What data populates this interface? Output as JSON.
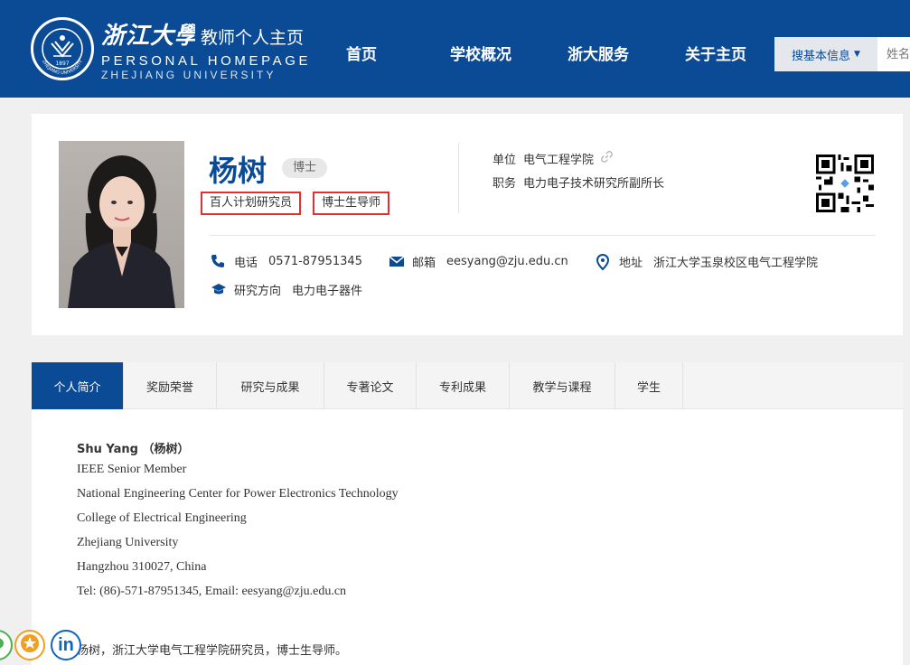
{
  "header": {
    "logo_cn": "浙江大學",
    "logo_sub": "教师个人主页",
    "logo_en1": "PERSONAL HOMEPAGE",
    "logo_en2": "ZHEJIANG UNIVERSITY",
    "seal_year": "1897",
    "seal_text": "ZHEJIANG UNIVERSITY",
    "nav": [
      "首页",
      "学校概况",
      "浙大服务",
      "关于主页"
    ],
    "search": {
      "select_label": "搜基本信息",
      "placeholder": "姓名"
    }
  },
  "profile": {
    "name": "杨树",
    "degree": "博士",
    "tags": [
      "百人计划研究员",
      "博士生导师"
    ],
    "unit_label": "单位",
    "unit_value": "电气工程学院",
    "position_label": "职务",
    "position_value": "电力电子技术研究所副所长",
    "phone_label": "电话",
    "phone_value": "0571-87951345",
    "email_label": "邮箱",
    "email_value": "eesyang@zju.edu.cn",
    "address_label": "地址",
    "address_value": "浙江大学玉泉校区电气工程学院",
    "research_label": "研究方向",
    "research_value": "电力电子器件"
  },
  "tabs": [
    "个人简介",
    "奖励荣誉",
    "研究与成果",
    "专著论文",
    "专利成果",
    "教学与课程",
    "学生"
  ],
  "active_tab": 0,
  "bio": {
    "name_line": "Shu Yang （杨树）",
    "lines": [
      "IEEE Senior Member",
      "National Engineering Center for Power Electronics Technology",
      "College of Electrical Engineering",
      "Zhejiang University",
      "Hangzhou 310027, China",
      "Tel: (86)-571-87951345, Email: eesyang@zju.edu.cn"
    ],
    "intro": "杨树，浙江大学电气工程学院研究员，博士生导师。"
  },
  "share": {
    "linkedin_label": "in",
    "colors": {
      "wechat": "#4caf50",
      "favorite": "#f0a020",
      "linkedin": "#0a66c2"
    }
  },
  "colors": {
    "brand": "#0b4a95",
    "tag_border": "#e03131"
  }
}
